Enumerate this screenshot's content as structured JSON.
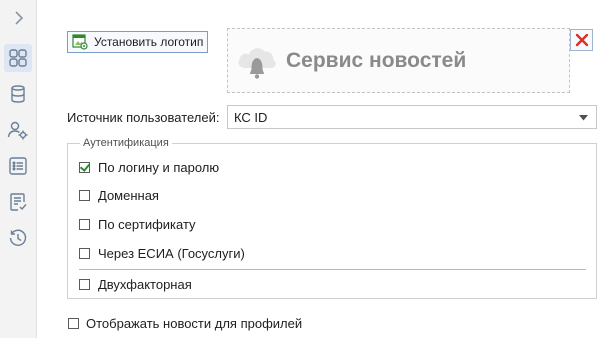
{
  "sidebar": {
    "items": [
      {
        "icon": "chevron-right-icon"
      },
      {
        "icon": "dashboard-grid-icon",
        "active": true
      },
      {
        "icon": "database-icon"
      },
      {
        "icon": "users-settings-icon"
      },
      {
        "icon": "list-icon"
      },
      {
        "icon": "document-check-icon"
      },
      {
        "icon": "history-icon"
      }
    ]
  },
  "logo": {
    "set_button_label": "Установить логотип",
    "preview_text": "Сервис новостей"
  },
  "user_source": {
    "label": "Источник пользователей:",
    "value": "КС ID"
  },
  "authentication": {
    "legend": "Аутентификация",
    "options": [
      {
        "label": "По логину и паролю",
        "checked": true
      },
      {
        "label": "Доменная",
        "checked": false
      },
      {
        "label": "По сертификату",
        "checked": false
      },
      {
        "label": "Через ЕСИА (Госуслуги)",
        "checked": false
      },
      {
        "label": "Двухфакторная",
        "checked": false
      }
    ]
  },
  "profile_news": {
    "label": "Отображать новости для профилей",
    "checked": false
  },
  "colors": {
    "accent": "#2f8a2f",
    "remove": "#d9302a",
    "sidebar_active": "#dde6f2"
  }
}
